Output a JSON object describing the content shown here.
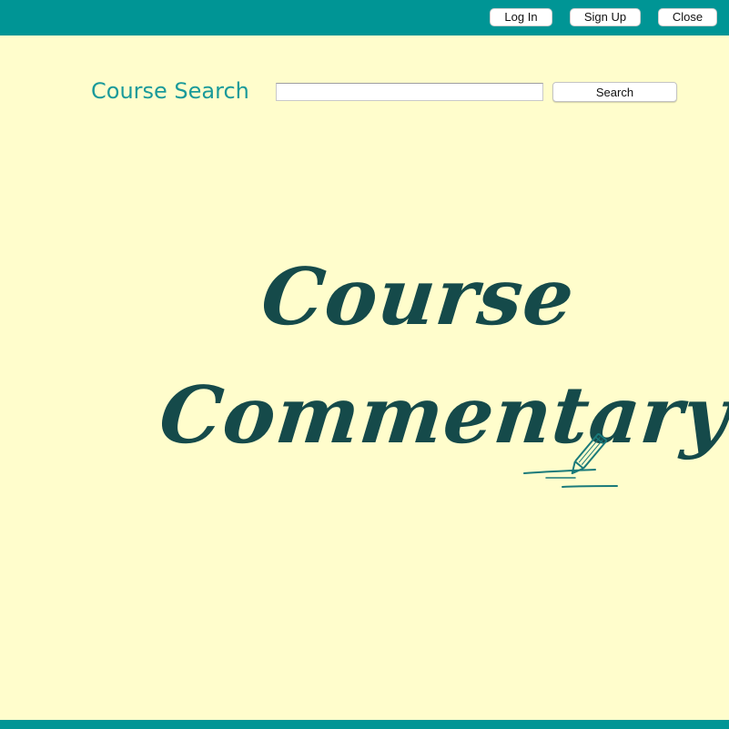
{
  "header": {
    "login_label": "Log In",
    "signup_label": "Sign Up",
    "close_label": "Close",
    "bar_color": "#009595"
  },
  "search": {
    "label": "Course Search",
    "value": "",
    "placeholder": "",
    "button_label": "Search"
  },
  "logo": {
    "line1": "Course",
    "line2": "Commentary",
    "color": "#154a4a",
    "icon": "pencil-icon"
  },
  "theme": {
    "background": "#fffdcc",
    "accent": "#1a9a9a"
  }
}
